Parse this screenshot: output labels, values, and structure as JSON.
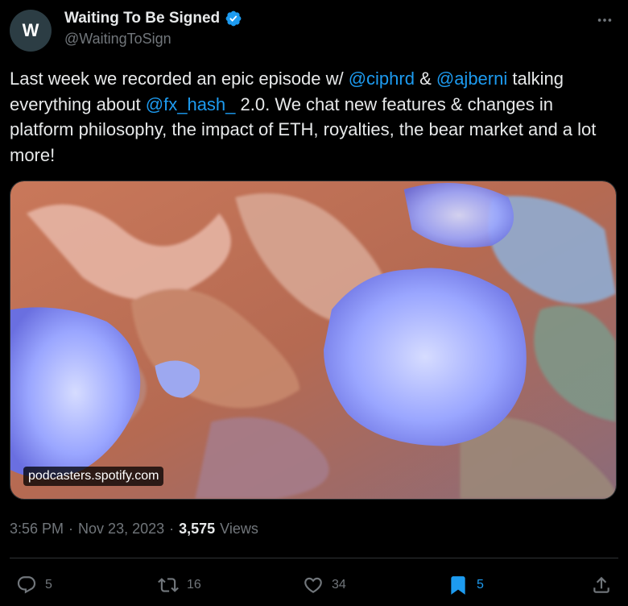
{
  "author": {
    "avatar_letter": "W",
    "display_name": "Waiting To Be Signed",
    "handle": "@WaitingToSign",
    "verified_color": "#1d9bf0"
  },
  "tweet": {
    "t1": "Last week we recorded an epic episode w/ ",
    "m1": "@ciphrd",
    "t2": " & ",
    "m2": "@ajberni",
    "t3": " talking everything  about ",
    "m3": "@fx_hash_",
    "t4": " 2.0. We chat new features & changes in platform philosophy, the impact of ETH, royalties, the bear market and a lot more!"
  },
  "media": {
    "domain": "podcasters.spotify.com"
  },
  "meta": {
    "time": "3:56 PM",
    "sep1": "·",
    "date": "Nov 23, 2023",
    "sep2": "·",
    "views_count": "3,575",
    "views_label": "Views"
  },
  "actions": {
    "reply": {
      "icon": "reply-icon",
      "count": "5"
    },
    "repost": {
      "icon": "repost-icon",
      "count": "16"
    },
    "like": {
      "icon": "heart-icon",
      "count": "34"
    },
    "bookmark": {
      "icon": "bookmark-icon",
      "count": "5"
    },
    "share": {
      "icon": "share-icon"
    }
  },
  "colors": {
    "accent": "#1d9bf0",
    "muted": "#71767b",
    "text": "#e7e9ea",
    "background": "#000000"
  }
}
